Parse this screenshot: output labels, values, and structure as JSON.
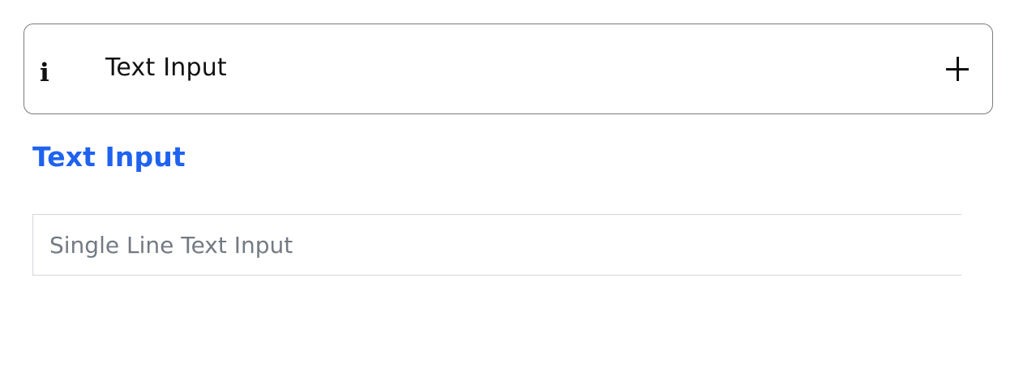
{
  "accordion": {
    "title": "Text Input",
    "info_icon_glyph": "i",
    "info_icon": "info-icon",
    "expand_icon": "plus-icon"
  },
  "field": {
    "label": "Text Input",
    "value": "",
    "placeholder": "Single Line Text Input"
  },
  "colors": {
    "label_accent": "#1f62f0",
    "border": "#777b80",
    "input_border": "#d4d7dc",
    "placeholder": "#747a82"
  }
}
